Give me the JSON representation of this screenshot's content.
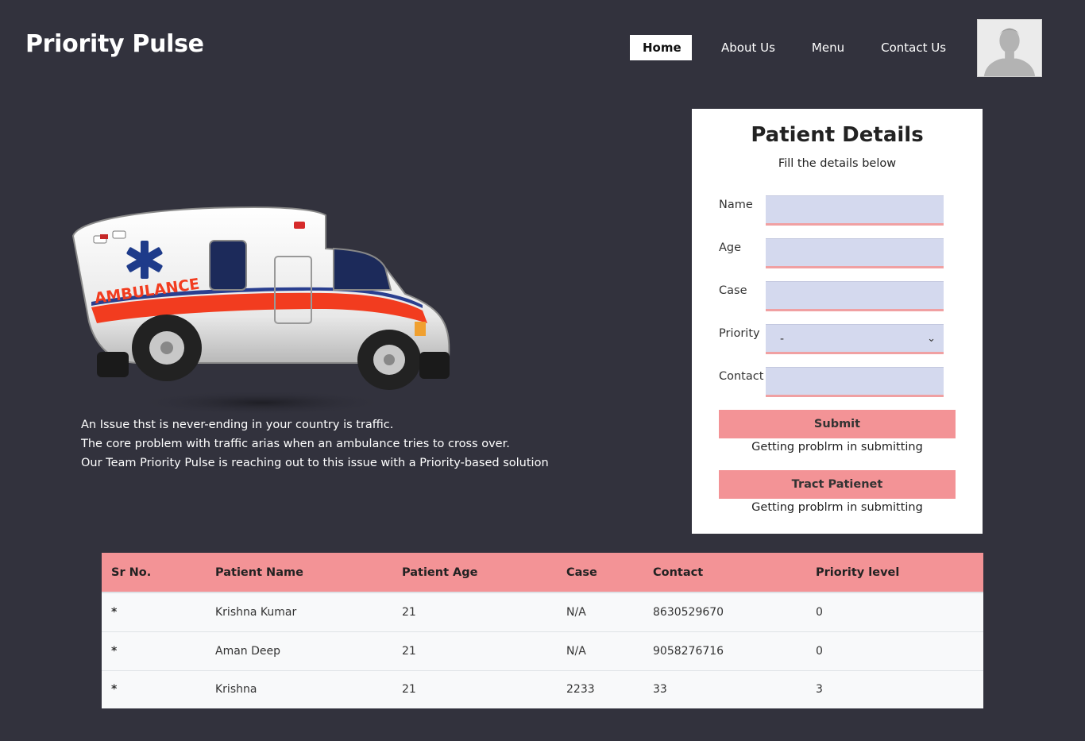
{
  "header": {
    "brand": "Priority Pulse",
    "nav": [
      {
        "label": "Home",
        "active": true
      },
      {
        "label": "About Us"
      },
      {
        "label": "Menu"
      },
      {
        "label": "Contact Us"
      }
    ],
    "avatar_icon": "user-avatar-icon"
  },
  "hero": {
    "image_icon": "ambulance-illustration",
    "ambulance_text": "AMBULANCE",
    "lines": [
      "An Issue thst is never-ending in your country is traffic.",
      "The core problem with traffic arias when an ambulance tries to cross over.",
      "Our Team Priority Pulse is reaching out to this issue with a Priority-based solution"
    ]
  },
  "form": {
    "title": "Patient Details",
    "subtitle": "Fill the details below",
    "fields": {
      "name": {
        "label": "Name",
        "value": ""
      },
      "age": {
        "label": "Age",
        "value": ""
      },
      "case": {
        "label": "Case",
        "value": ""
      },
      "priority": {
        "label": "Priority",
        "value": "-"
      },
      "contact": {
        "label": "Contact",
        "value": ""
      }
    },
    "submit_label": "Submit",
    "submit_note": "Getting problrm in submitting",
    "track_label": "Tract Patienet",
    "track_note": "Getting problrm in submitting"
  },
  "table": {
    "headers": [
      "Sr No.",
      "Patient Name",
      "Patient Age",
      "Case",
      "Contact",
      "Priority level"
    ],
    "rows": [
      [
        "*",
        "Krishna Kumar",
        "21",
        "N/A",
        "8630529670",
        "0"
      ],
      [
        "*",
        "Aman Deep",
        "21",
        "N/A",
        "9058276716",
        "0"
      ],
      [
        "*",
        "Krishna",
        "21",
        "2233",
        "33",
        "3"
      ]
    ]
  },
  "colors": {
    "background": "#32323d",
    "accent": "#f39396",
    "input_bg": "#d4d9ee",
    "card_bg": "#ffffff"
  }
}
